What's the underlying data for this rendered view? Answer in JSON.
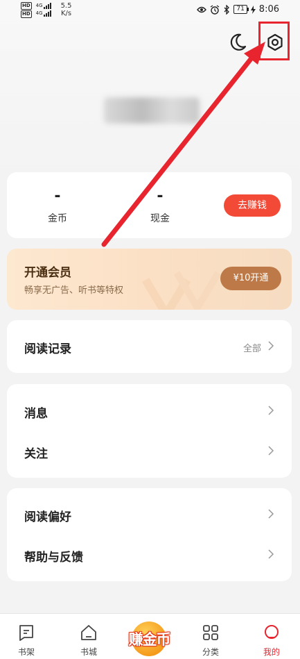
{
  "status_bar": {
    "hd_labels": [
      "HD",
      "HD"
    ],
    "signal_labels": [
      "4G",
      "4G"
    ],
    "net_speed_value": "5.5",
    "net_speed_unit": "K/s",
    "battery": "71",
    "time": "8:06"
  },
  "header": {
    "icons": [
      "moon-icon",
      "gear-icon"
    ],
    "username": ""
  },
  "wallet": {
    "coins_value": "-",
    "coins_label": "金币",
    "cash_value": "-",
    "cash_label": "现金",
    "earn_button": "去赚钱"
  },
  "vip": {
    "title": "开通会员",
    "subtitle": "畅享无广告、听书等特权",
    "button": "¥10开通"
  },
  "menu": {
    "reading_history": {
      "label": "阅读记录",
      "hint": "全部"
    },
    "messages": {
      "label": "消息"
    },
    "follow": {
      "label": "关注"
    },
    "reading_prefs": {
      "label": "阅读偏好"
    },
    "help_feedback": {
      "label": "帮助与反馈"
    }
  },
  "bottom_nav": {
    "bookshelf": "书架",
    "bookstore": "书城",
    "earn_coins": "赚金币",
    "categories": "分类",
    "mine": "我的"
  },
  "colors": {
    "accent_red": "#e8242f",
    "earn_button": "#f24a37",
    "vip_button": "#bd7a48"
  }
}
